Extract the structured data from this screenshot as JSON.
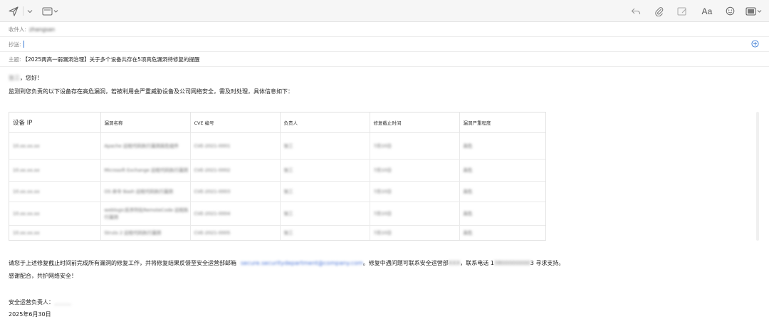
{
  "composer": {
    "to_label": "收件人:",
    "to_value": "zhangsan",
    "cc_label": "抄送:",
    "subject_label": "主题:",
    "subject_value": "【2025两高一弱漏洞治理】关于多个设备共存在5项高危漏洞待修复的提醒"
  },
  "toolbar": {
    "font_label": "Aa"
  },
  "body": {
    "greeting_name": "张三",
    "greeting": "，您好！",
    "intro": "监测到您负责的以下设备存在高危漏洞，若被利用会严重威胁设备及公司网络安全，需及时处理，具体信息如下：",
    "para1_a": "请您于上述修复截止时间前完成所有漏洞的修复工作，并将修复结果反馈至安全运营部邮箱",
    "para1_email": "secure.securitydepartment@company.com",
    "para1_b": "。修复中遇问题可联系安全运营部",
    "para1_contact": "XXX",
    "para1_c": "，联系电话 1",
    "para1_phone": "3800000000",
    "para1_d": "3 寻求支持。",
    "thanks": "感谢配合，共护网络安全！",
    "sign_label": "安全运营负责人：",
    "sign_name": "＿＿＿",
    "date": "2025年6月30日"
  },
  "table": {
    "headers": [
      "设备 IP",
      "漏洞名称",
      "CVE 编号",
      "负责人",
      "修复截止时间",
      "漏洞严重程度"
    ],
    "rows": [
      [
        "10.xx.xx.xx",
        "Apache 远程代码执行漏洞高危组件",
        "CVE-2021-0001",
        "张三",
        "7月10日",
        "高危"
      ],
      [
        "10.xx.xx.xx",
        "Microsoft Exchange 远程代码执行漏洞",
        "CVE-2021-0002",
        "张三",
        "7月10日",
        "高危"
      ],
      [
        "10.xx.xx.xx",
        "OS 命令 Bash 远程代码执行漏洞",
        "CVE-2021-0003",
        "张三",
        "7月10日",
        "高危"
      ],
      [
        "10.xx.xx.xx",
        "weblogic反序列化RemoteCode 远程执行漏洞",
        "CVE-2021-0004",
        "张三",
        "7月10日",
        "高危"
      ],
      [
        "10.xx.xx.xx",
        "Struts 2 远程代码执行漏洞",
        "CVE-2021-0005",
        "张三",
        "7月10日",
        "高危"
      ]
    ]
  }
}
